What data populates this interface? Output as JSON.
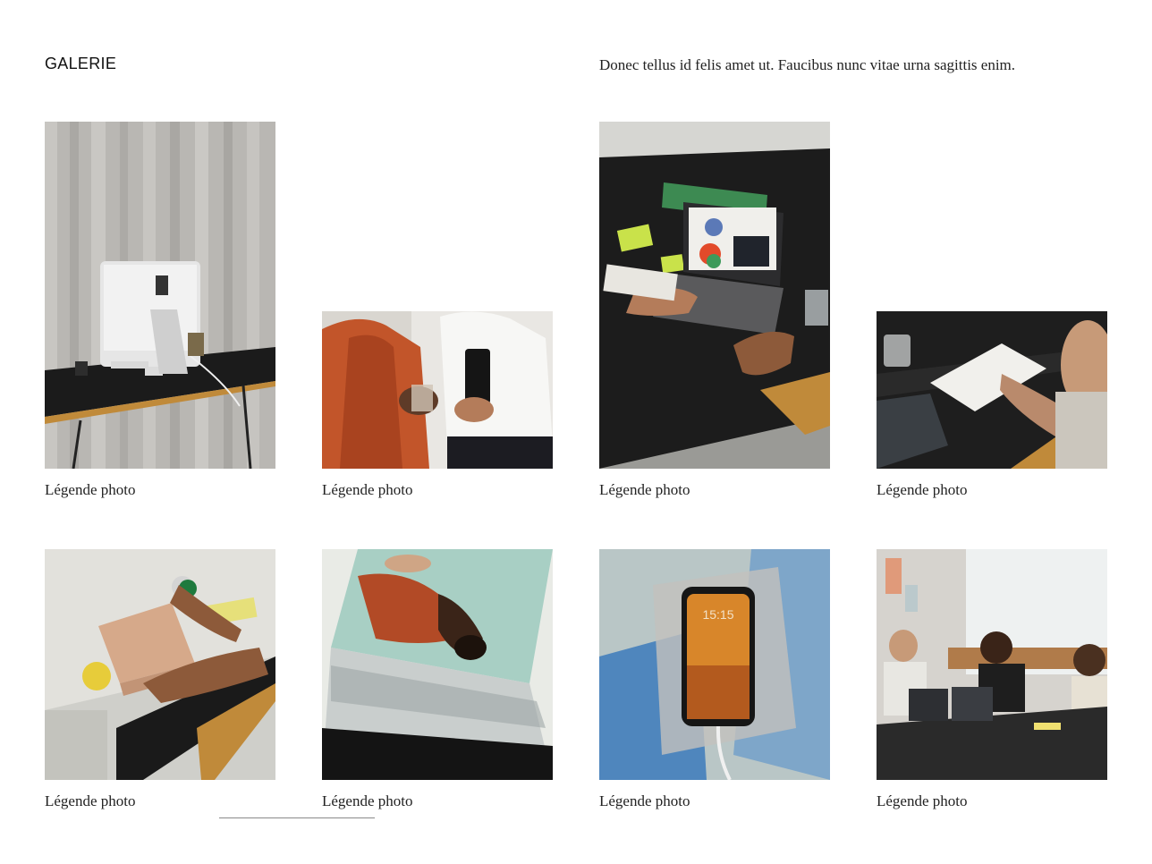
{
  "header": {
    "title": "GALERIE",
    "intro": "Donec tellus id felis amet ut. Faucibus nunc vitae urna sagittis enim."
  },
  "gallery": [
    {
      "caption": "Légende photo",
      "image": "desktop-computer-on-black-desk"
    },
    {
      "caption": "Légende photo",
      "image": "two-people-holding-phone-and-drink"
    },
    {
      "caption": "Légende photo",
      "image": "laptop-on-table-with-sticky-notes"
    },
    {
      "caption": "Légende photo",
      "image": "person-writing-in-notebook"
    },
    {
      "caption": "Légende photo",
      "image": "hands-holding-pink-box"
    },
    {
      "caption": "Légende photo",
      "image": "magazine-page-with-portrait"
    },
    {
      "caption": "Légende photo",
      "image": "smartphone-on-blue-paper"
    },
    {
      "caption": "Légende photo",
      "image": "team-meeting-with-laptops"
    }
  ]
}
